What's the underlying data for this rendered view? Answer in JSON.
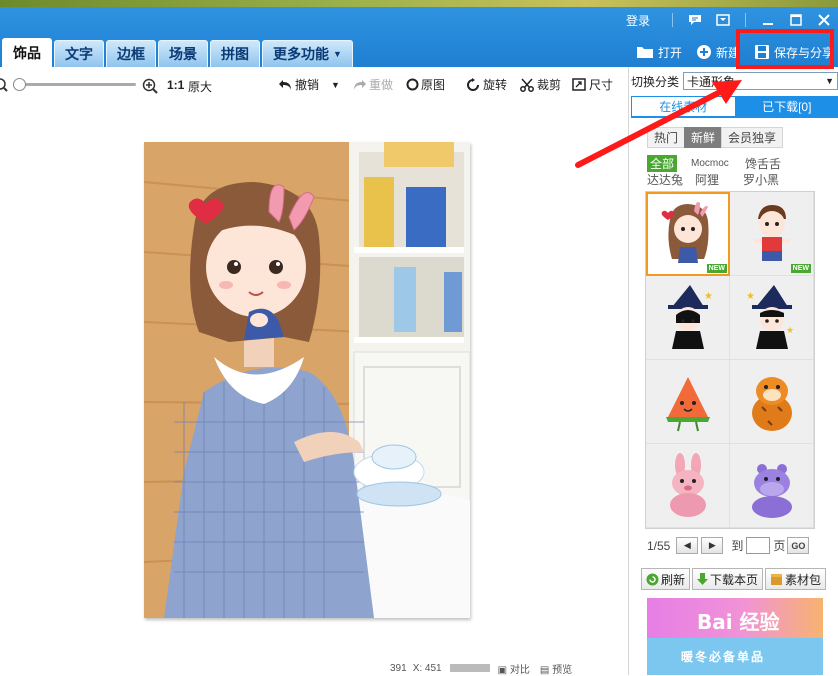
{
  "titlebar": {
    "login": "登录",
    "tabs": [
      {
        "label": "饰品",
        "active": true
      },
      {
        "label": "文字"
      },
      {
        "label": "边框"
      },
      {
        "label": "场景"
      },
      {
        "label": "拼图"
      },
      {
        "label": "更多功能"
      }
    ],
    "actions": {
      "open": "打开",
      "new": "新建",
      "save_share": "保存与分享"
    }
  },
  "toolbar": {
    "one_to_one": "1:1",
    "original_size": "原大",
    "undo": "撤销",
    "redo": "重做",
    "original": "原图",
    "rotate": "旋转",
    "crop": "裁剪",
    "size": "尺寸",
    "zoom_level": 0
  },
  "canvas": {
    "status_x": "391",
    "status_y": "X: 451",
    "compare": "对比",
    "preview": "预览"
  },
  "panel": {
    "category_label": "切换分类",
    "category_value": "卡通形象",
    "tab_online": "在线素材",
    "tab_downloaded": "已下载[0]",
    "subtabs": [
      "热门",
      "新鲜",
      "会员独享"
    ],
    "active_subtab": "新鲜",
    "filters_row1": [
      "全部",
      "Mocmoc",
      "馋舌舌"
    ],
    "filters_row2": [
      "达达兔",
      "阿狸",
      "罗小黑"
    ],
    "items": [
      {
        "name": "rabbit-ear-girl",
        "badge": "NEW",
        "selected": true
      },
      {
        "name": "boy-sticker",
        "badge": "NEW"
      },
      {
        "name": "witch-girl-dark"
      },
      {
        "name": "witch-boy-dark"
      },
      {
        "name": "watermelon-slice"
      },
      {
        "name": "orange-tiger"
      },
      {
        "name": "pink-bunny-plush"
      },
      {
        "name": "purple-hippo-plush"
      }
    ],
    "pager": {
      "page": "1/55",
      "to": "到",
      "page_unit": "页",
      "go": "GO"
    },
    "buttons": {
      "refresh": "刷新",
      "download_page": "下载本页",
      "material_pack": "素材包"
    },
    "banner": {
      "line1": "Bai 经验",
      "line2": "暖冬必备单品"
    }
  },
  "colors": {
    "brand_blue": "#1e8fe6",
    "highlight_red": "#ff1a1a",
    "new_green": "#4aa832",
    "select_orange": "#f29a1f"
  }
}
